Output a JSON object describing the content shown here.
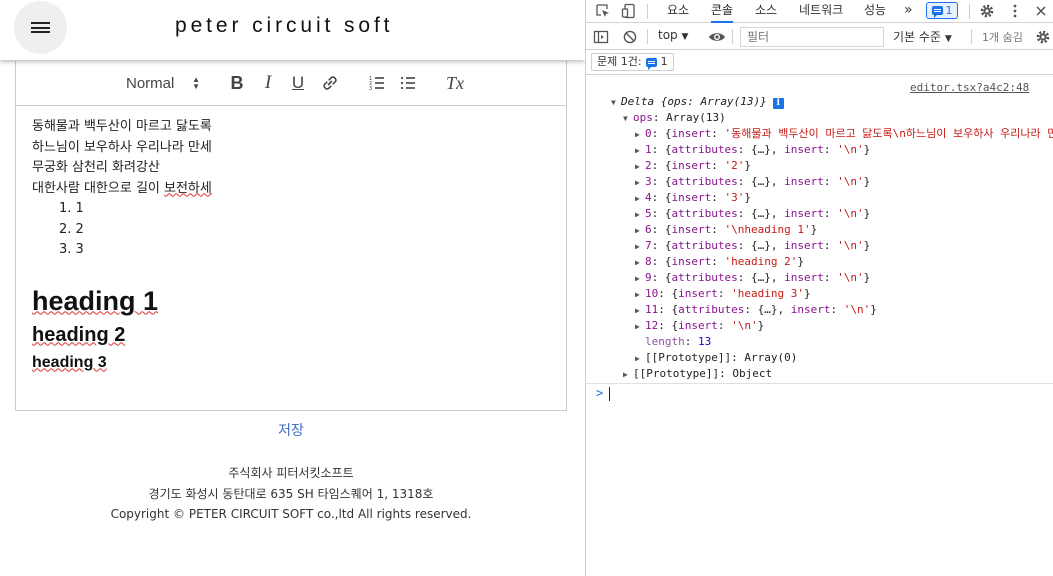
{
  "app": {
    "title": "peter circuit soft",
    "toolbar": {
      "header_select": "Normal",
      "bold": "B",
      "italic": "I",
      "underline": "U",
      "clean": "Tx"
    },
    "content": {
      "lines": [
        "동해물과 백두산이 마르고 닳도록",
        "하느님이 보우하사 우리나라 만세",
        "무궁화 삼천리 화려강산"
      ],
      "line4_pre": "대한사람 대한으로 길이 ",
      "line4_spell": "보전하세",
      "list": [
        "1. 1",
        "2. 2",
        "3. 3"
      ],
      "heading1": "heading 1",
      "heading2": "heading 2",
      "heading3": "heading 3"
    },
    "save_label": "저장",
    "footer": {
      "company": "주식회사 피터서킷소프트",
      "address": "경기도 화성시 동탄대로 635 SH 타임스퀘어 1, 1318호",
      "copyright": "Copyright © PETER CIRCUIT SOFT co.,ltd All rights reserved."
    }
  },
  "devtools": {
    "tabs": [
      "요소",
      "콘솔",
      "소스",
      "네트워크",
      "성능"
    ],
    "active_tab": "콘솔",
    "more_tabs": "»",
    "issues_count": "1",
    "context": "top",
    "filter_placeholder": "필터",
    "level": "기본 수준",
    "hidden": "1개 숨김",
    "issues_label": "문제 1건:",
    "issues_num": "1",
    "console": {
      "source_link": "editor.tsx?a4c2:48",
      "delta_label": "Delta {ops: Array(13)}",
      "ops_key": "ops",
      "ops_val": "Array(13)",
      "items": [
        {
          "idx": "0",
          "kind": "insert",
          "val": "'동해물과 백두산이 마르고 닳도록\\n하느님이 보우하사 우리나라 만"
        },
        {
          "idx": "1",
          "kind": "attr",
          "val": "'\\n'"
        },
        {
          "idx": "2",
          "kind": "insert",
          "val": "'2'"
        },
        {
          "idx": "3",
          "kind": "attr",
          "val": "'\\n'"
        },
        {
          "idx": "4",
          "kind": "insert",
          "val": "'3'"
        },
        {
          "idx": "5",
          "kind": "attr",
          "val": "'\\n'"
        },
        {
          "idx": "6",
          "kind": "insert",
          "val": "'\\nheading 1'"
        },
        {
          "idx": "7",
          "kind": "attr",
          "val": "'\\n'"
        },
        {
          "idx": "8",
          "kind": "insert",
          "val": "'heading 2'"
        },
        {
          "idx": "9",
          "kind": "attr",
          "val": "'\\n'"
        },
        {
          "idx": "10",
          "kind": "insert",
          "val": "'heading 3'"
        },
        {
          "idx": "11",
          "kind": "attr",
          "val": "'\\n'"
        },
        {
          "idx": "12",
          "kind": "insert",
          "val": "'\\n'"
        }
      ],
      "length_key": "length",
      "length_val": "13",
      "proto_array": "[[Prototype]]: Array(0)",
      "proto_object": "[[Prototype]]: Object"
    },
    "prompt_symbol": ">"
  }
}
